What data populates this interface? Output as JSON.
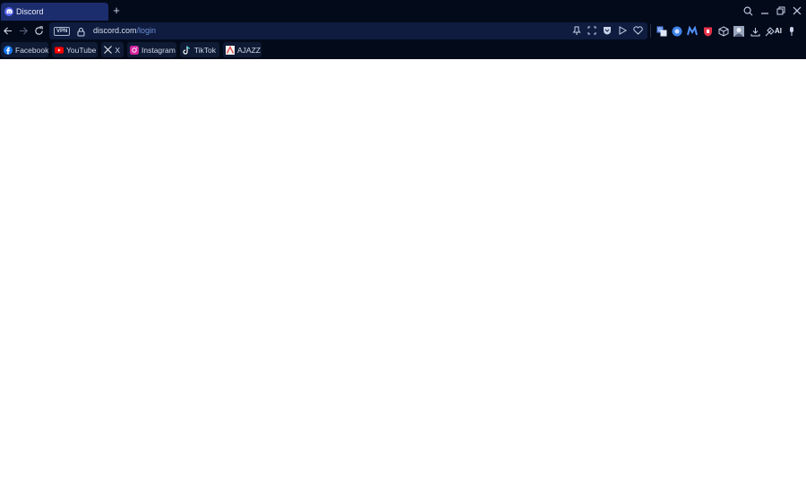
{
  "tab": {
    "title": "Discord",
    "new_tab": "+"
  },
  "address": {
    "vpn": "VPN",
    "host": "discord.com",
    "path": "/login"
  },
  "toolbar": {
    "ai": "AI"
  },
  "bookmarks": [
    {
      "label": "Facebook"
    },
    {
      "label": "YouTube"
    },
    {
      "label": "X"
    },
    {
      "label": "Instagram"
    },
    {
      "label": "TikTok"
    },
    {
      "label": "AJAZZ"
    }
  ],
  "colors": {
    "chrome_bg": "#030a1a",
    "active_tab": "#1c2d6e",
    "omnibox": "#0f1c3f",
    "url_path": "#6b8fd6",
    "discord": "#5865f2"
  },
  "icons": {
    "window": [
      "search-icon",
      "minimize-icon",
      "restore-icon",
      "close-icon"
    ],
    "nav": [
      "back-icon",
      "forward-icon",
      "reload-icon",
      "lock-icon"
    ],
    "omnibox": [
      "pin-icon",
      "screenshot-icon",
      "shield-icon",
      "play-icon",
      "heart-icon"
    ],
    "extensions": [
      "translate-icon",
      "circle-extension-icon",
      "m-extension-icon",
      "red-shield-icon",
      "cube-icon",
      "avatar-icon",
      "download-icon",
      "ai-wand-icon",
      "microphone-icon"
    ]
  }
}
